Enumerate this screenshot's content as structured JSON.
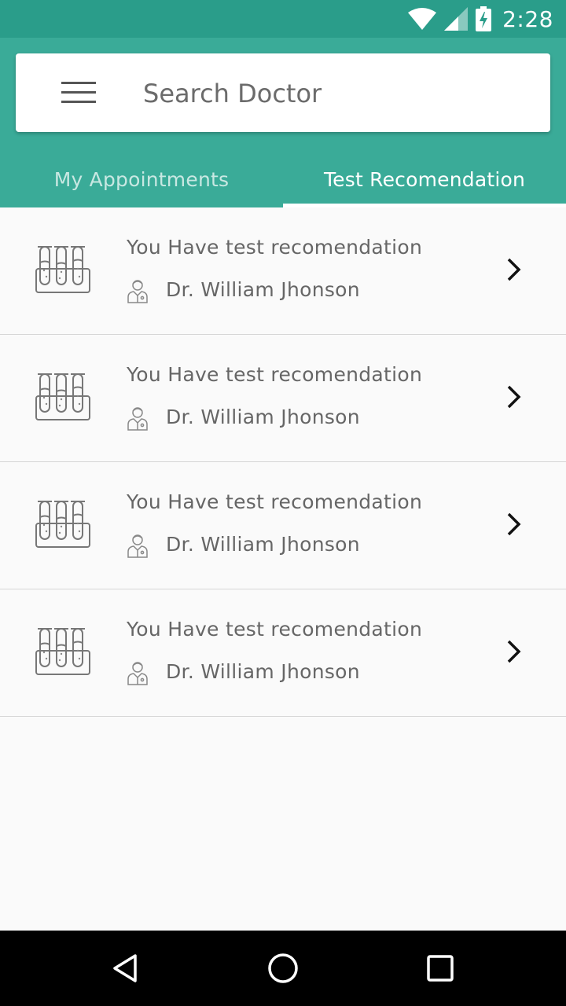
{
  "status_bar": {
    "time": "2:28",
    "icons": [
      "wifi-icon",
      "cell-signal-icon",
      "battery-charging-icon"
    ],
    "background": "#2a9d8a"
  },
  "header": {
    "background": "#3aab98",
    "menu_icon": "hamburger-menu-icon",
    "search": {
      "placeholder": "Search Doctor",
      "value": ""
    },
    "tabs": [
      {
        "label": "My Appointments",
        "active": false
      },
      {
        "label": "Test Recomendation",
        "active": true
      }
    ]
  },
  "recommendations": [
    {
      "title": "You Have test recomendation",
      "doctor": "Dr. William Jhonson",
      "icon": "test-tubes-icon"
    },
    {
      "title": "You Have test recomendation",
      "doctor": "Dr. William Jhonson",
      "icon": "test-tubes-icon"
    },
    {
      "title": "You Have test recomendation",
      "doctor": "Dr. William Jhonson",
      "icon": "test-tubes-icon"
    },
    {
      "title": "You Have test recomendation",
      "doctor": "Dr. William Jhonson",
      "icon": "test-tubes-icon"
    }
  ],
  "nav_bar": {
    "buttons": [
      "back-icon",
      "home-icon",
      "recents-icon"
    ]
  }
}
